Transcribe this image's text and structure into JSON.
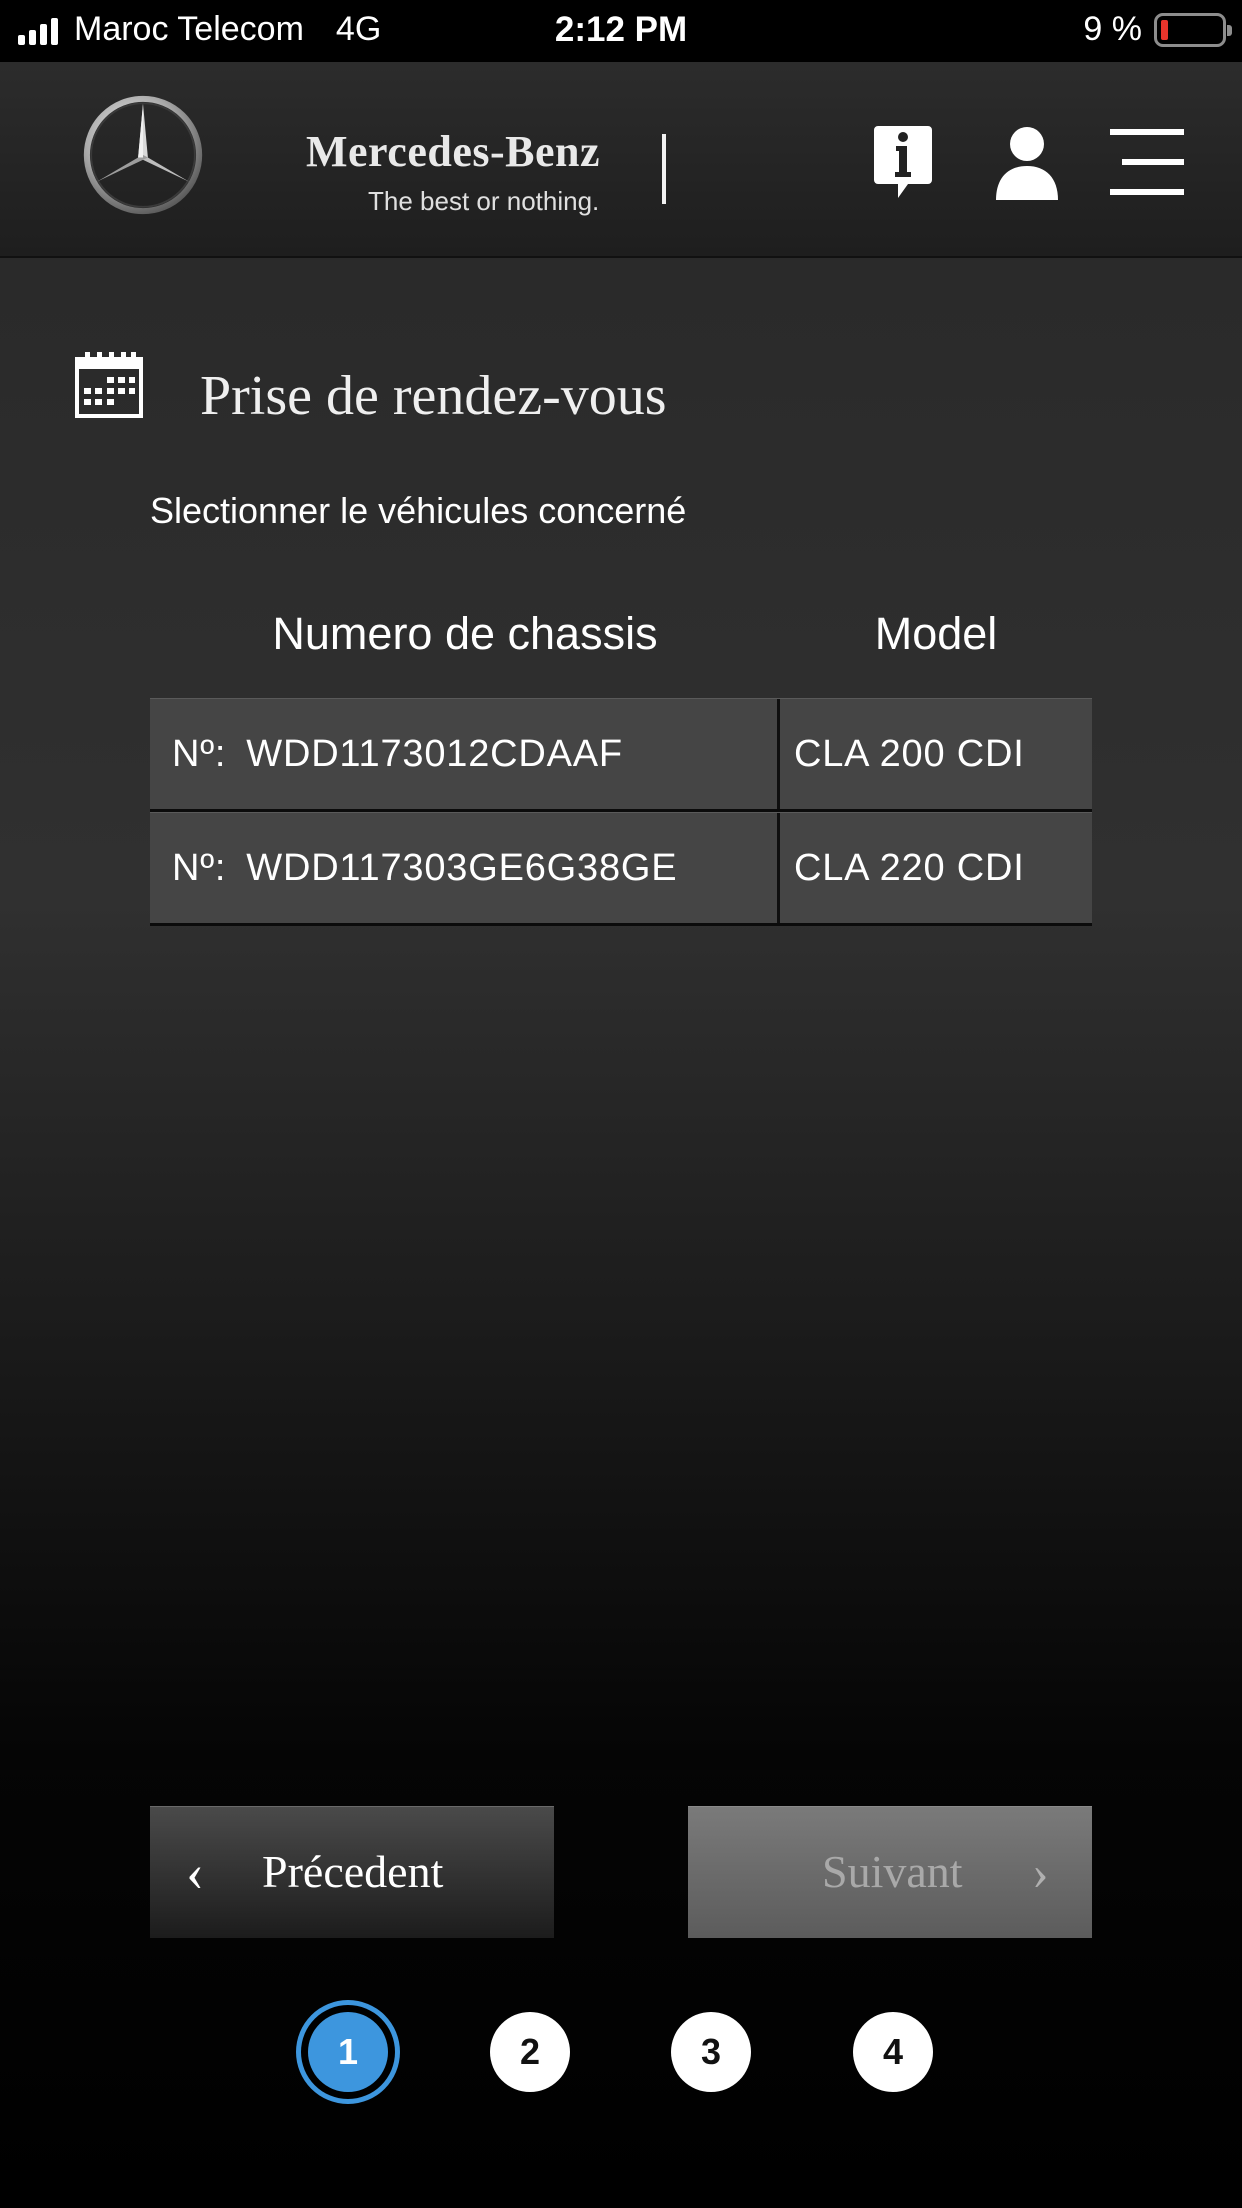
{
  "status_bar": {
    "carrier": "Maroc Telecom",
    "network": "4G",
    "time": "2:12 PM",
    "battery": "9 %"
  },
  "header": {
    "brand_name": "Mercedes-Benz",
    "tagline": "The best or nothing.",
    "icons": [
      "info-icon",
      "user-icon",
      "menu-icon"
    ]
  },
  "page": {
    "title": "Prise de rendez-vous",
    "subtitle": "Slectionner le véhicules concerné"
  },
  "table": {
    "columns": [
      "Numero de chassis",
      "Model"
    ],
    "rows": [
      {
        "prefix": "Nº:",
        "chassis": "WDD1173012CDAAF",
        "model": "CLA 200 CDI"
      },
      {
        "prefix": "Nº:",
        "chassis": "WDD117303GE6G38GE",
        "model": "CLA 220 CDI"
      }
    ]
  },
  "nav": {
    "prev_label": "Précedent",
    "prev_chevron": "‹",
    "next_label": "Suivant",
    "next_chevron": "›"
  },
  "steps": [
    "1",
    "2",
    "3",
    "4"
  ],
  "active_step": "1",
  "colors": {
    "accent": "#3d96de",
    "battery_low": "#e8342b"
  }
}
